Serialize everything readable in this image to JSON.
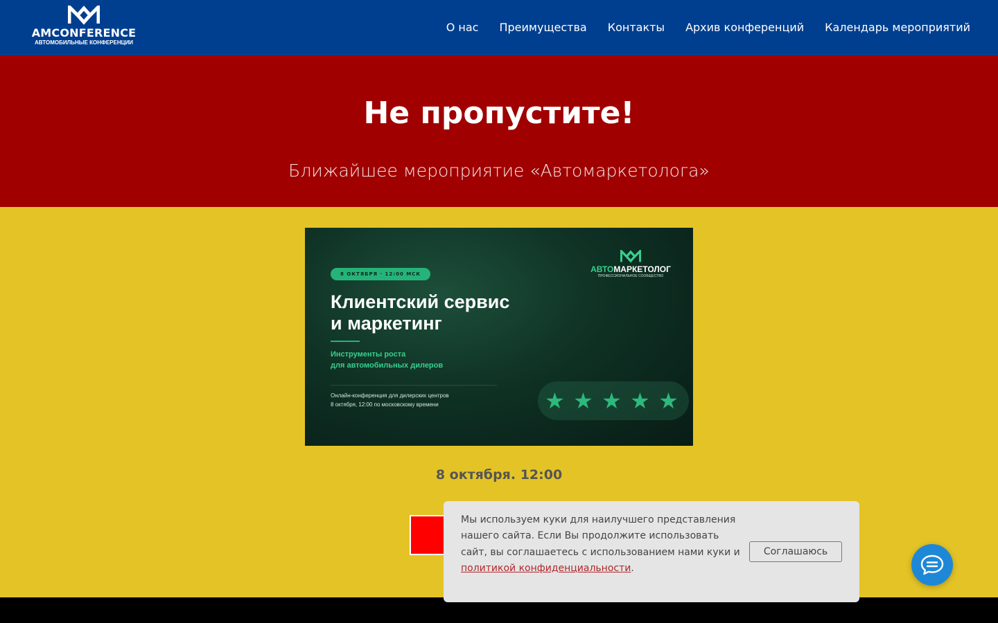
{
  "header": {
    "logo_title": "AMCONFERENCE",
    "logo_subtitle": "АВТОМОБИЛЬНЫЕ КОНФЕРЕНЦИИ",
    "nav": [
      "О нас",
      "Преимущества",
      "Контакты",
      "Архив конференций",
      "Календарь мероприятий"
    ]
  },
  "hero": {
    "title": "Не пропустите!",
    "subtitle": "Ближайшее мероприятие «Автомаркетолога»"
  },
  "banner": {
    "badge": "8 ОКТЯБРЯ · 12:00 МСК",
    "title": "Клиентский сервис\nи маркетинг",
    "subtitle": "Инструменты роста\nдля автомобильных дилеров",
    "info": "Онлайн-конференция для дилерских центров\n8 октября, 12:00 по московскому времени",
    "brand_accent": "АВТО",
    "brand_rest": "МАРКЕТОЛОГ",
    "brand_sub": "ПРОФЕССИОНАЛЬНОЕ СООБЩЕСТВО",
    "rating": 5,
    "rating_max": 5
  },
  "event": {
    "date": "8 октября. 12:00"
  },
  "cookie": {
    "text_before": "Мы используем куки для наилучшего представления нашего сайта. Если Вы продолжите использовать сайт, вы соглашаетесь с использованием нами куки и ",
    "link": "политикой конфиденциальности",
    "text_after": ".",
    "accept": "Соглашаюсь"
  },
  "colors": {
    "header_bg": "#003f8f",
    "hero_bg": "#a00000",
    "page_bg": "#e4c326",
    "button_red": "#ff0000",
    "chat_blue": "#1e88d6",
    "accent_green": "#26b37a"
  },
  "icons": {
    "logo": "am-monogram-icon",
    "chat": "chat-bubble-icon",
    "star": "star-icon"
  }
}
